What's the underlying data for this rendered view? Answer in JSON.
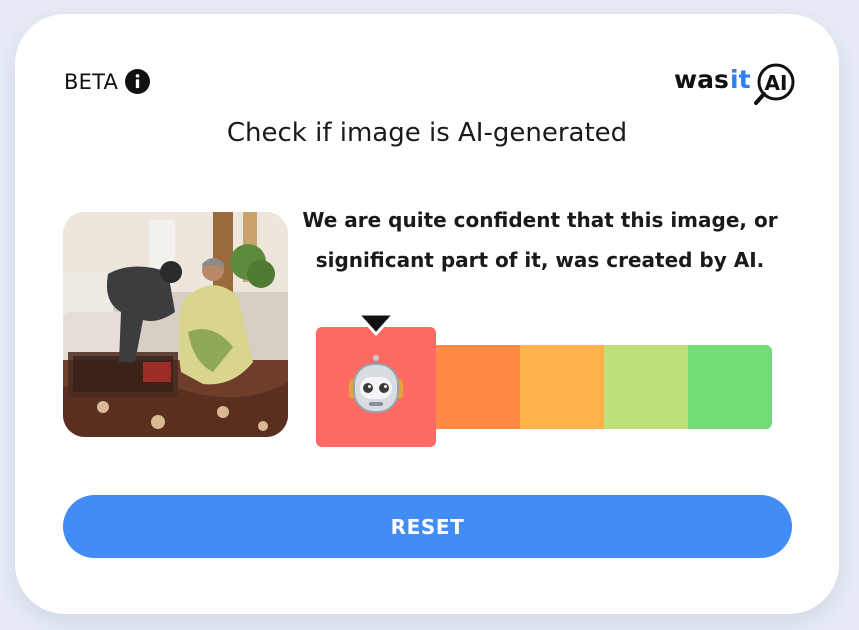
{
  "header": {
    "beta_label": "BETA",
    "info_icon": "info-icon",
    "logo_text_black": "was",
    "logo_text_blue": "it",
    "logo_text_ai": "AI"
  },
  "title": "Check if image is AI-generated",
  "result": {
    "image": "uploaded-photo",
    "verdict": "We are quite confident that this image, or significant part of it, was created by AI.",
    "meter": {
      "levels": 5,
      "selected_level": 1,
      "selected_icon": "robot-icon",
      "colors": [
        "#ff6a63",
        "#ff8a48",
        "#ffb14a",
        "#bfe07a",
        "#74dc76"
      ]
    }
  },
  "actions": {
    "reset_label": "RESET"
  },
  "colors": {
    "accent": "#418cf5",
    "logo_blue": "#2f7ef5"
  }
}
